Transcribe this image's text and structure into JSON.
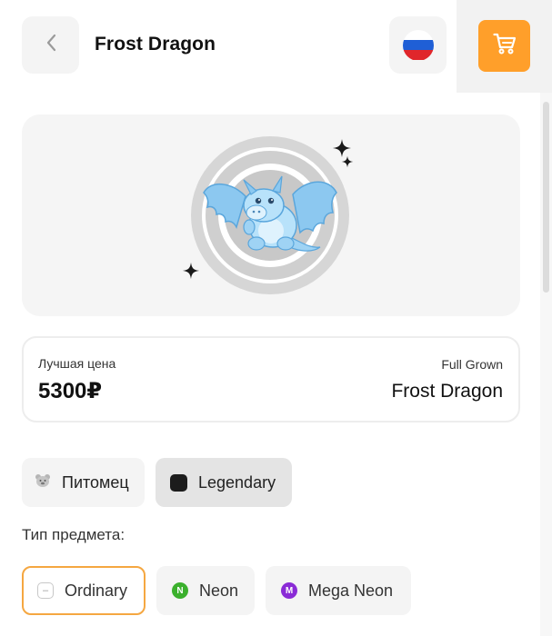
{
  "header": {
    "title": "Frost Dragon",
    "back_icon": "chevron-left-icon",
    "flag_icon": "russia-flag-icon",
    "flag_colors": [
      "#ffffff",
      "#1f5fd6",
      "#e0262b"
    ],
    "cart_icon": "cart-icon",
    "cart_color": "#ff9f2a"
  },
  "hero": {
    "image": "frost-dragon-pet-image",
    "sparkle_icon": "sparkle-icon"
  },
  "price_card": {
    "best_price_label": "Лучшая цена",
    "price": "5300₽",
    "growth": "Full Grown",
    "pet_name": "Frost Dragon"
  },
  "chips": [
    {
      "label": "Питомец",
      "icon": "pet-icon"
    },
    {
      "label": "Legendary",
      "icon": "rarity-square-icon",
      "color": "#1c1c1c"
    }
  ],
  "item_type": {
    "label": "Тип предмета:",
    "options": [
      {
        "label": "Ordinary",
        "badge": "–",
        "selected": true,
        "accent": "#f5a741"
      },
      {
        "label": "Neon",
        "badge": "N",
        "color": "#3bb02d"
      },
      {
        "label": "Mega Neon",
        "badge": "M",
        "color": "#8a2bd6"
      }
    ]
  }
}
